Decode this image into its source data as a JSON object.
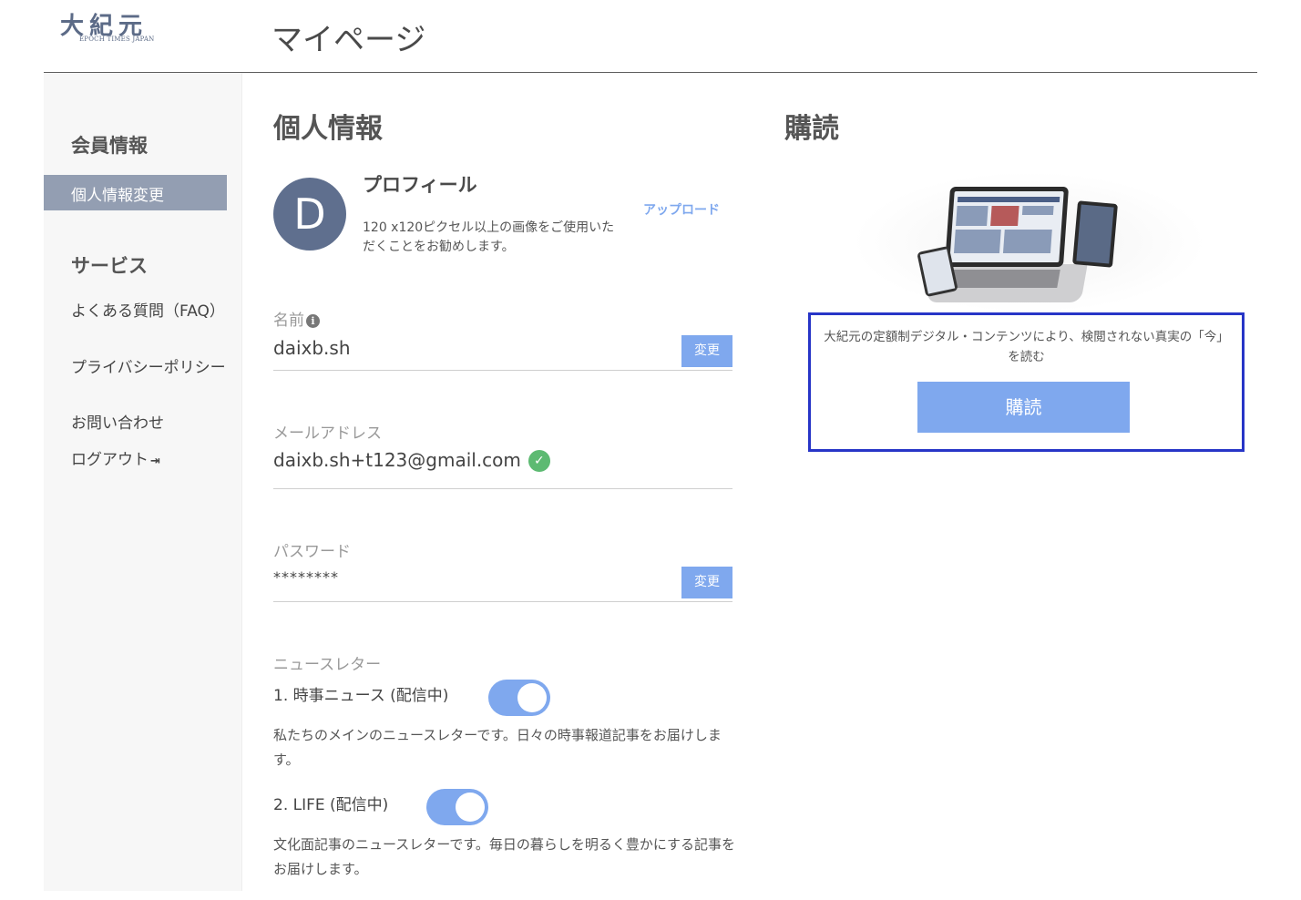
{
  "header": {
    "logo_text": "大紀元",
    "logo_sub": "EPOCH TIMES JAPAN",
    "page_title": "マイページ"
  },
  "sidebar": {
    "member_heading": "会員情報",
    "active_item": "個人情報変更",
    "service_heading": "サービス",
    "links": [
      {
        "label": "よくある質問（FAQ）"
      },
      {
        "label": "プライバシーポリシー"
      },
      {
        "label": "お問い合わせ"
      },
      {
        "label": "ログアウト"
      }
    ],
    "logout_icon": "sign-out-icon"
  },
  "personal": {
    "title": "個人情報",
    "avatar_letter": "D",
    "profile_title": "プロフィール",
    "profile_desc": "120 x120ピクセル以上の画像をご使用いただくことをお勧めします。",
    "upload_label": "アップロード",
    "name_label": "名前",
    "name_value": "daixb.sh",
    "email_label": "メールアドレス",
    "email_value": "daixb.sh+t123@gmail.com",
    "password_label": "パスワード",
    "password_value": "********",
    "change_label": "変更",
    "newsletter_label": "ニュースレター",
    "newsletters": [
      {
        "title": "1. 時事ニュース (配信中)",
        "desc": "私たちのメインのニュースレターです。日々の時事報道記事をお届けします。",
        "enabled": true
      },
      {
        "title": "2. LIFE (配信中)",
        "desc": "文化面記事のニュースレターです。毎日の暮らしを明るく豊かにする記事をお届けします。",
        "enabled": true
      }
    ]
  },
  "subscription": {
    "title": "購読",
    "description": "大紀元の定額制デジタル・コンテンツにより、検閲されない真実の「今」を読む",
    "button_label": "購読"
  },
  "colors": {
    "accent": "#7fa8ee",
    "sidebar_active": "#939eb2",
    "avatar": "#5f6f8e",
    "highlight_border": "#2735c7",
    "verified": "#5dba72"
  }
}
